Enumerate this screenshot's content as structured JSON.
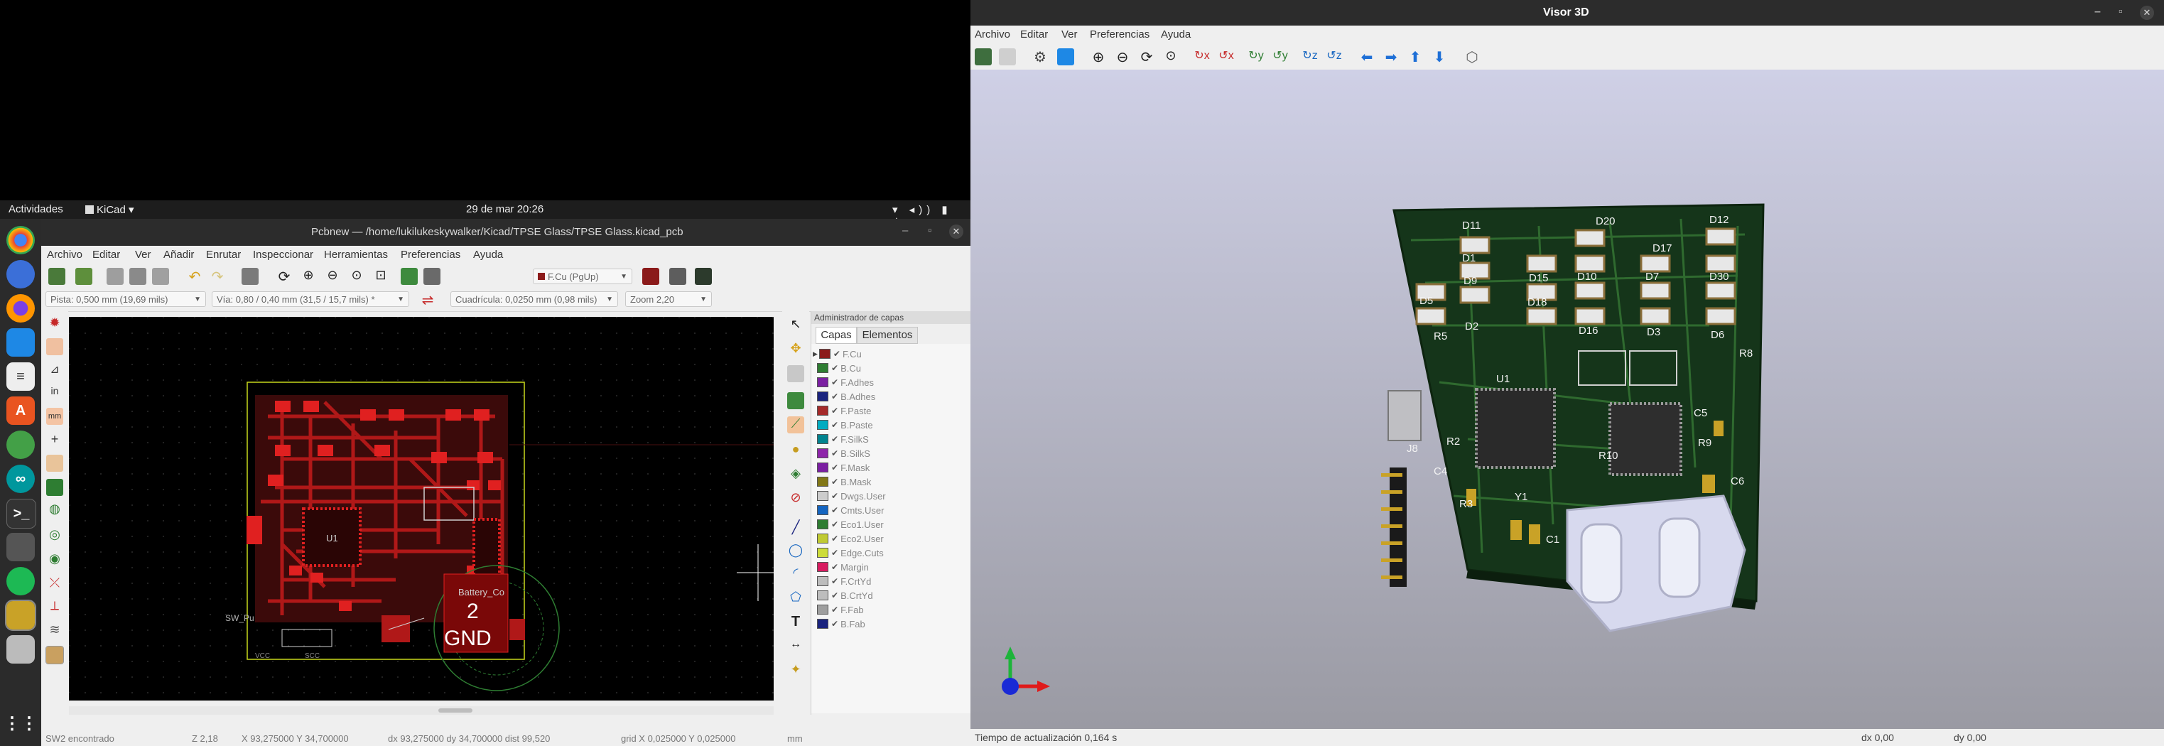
{
  "gnome": {
    "activities": "Actividades",
    "app_menu": "KiCad",
    "clock": "29 de mar  20:26"
  },
  "pcbnew": {
    "title": "Pcbnew — /home/lukilukeskywalker/Kicad/TPSE Glass/TPSE Glass.kicad_pcb",
    "menu": [
      "Archivo",
      "Editar",
      "Ver",
      "Añadir",
      "Enrutar",
      "Inspeccionar",
      "Herramientas",
      "Preferencias",
      "Ayuda"
    ],
    "layer_select": "F.Cu (PgUp)",
    "track": "Pista: 0,500 mm (19,69 mils)",
    "via": "Vía: 0,80 / 0,40 mm (31,5 / 15,7 mils) *",
    "grid": "Cuadrícula: 0,0250 mm (0,98 mils)",
    "zoom": "Zoom 2,20",
    "layers_manager": {
      "title": "Administrador de capas",
      "tabs": [
        "Capas",
        "Elementos"
      ],
      "layers": [
        {
          "name": "F.Cu",
          "color": "#8b1a1a"
        },
        {
          "name": "B.Cu",
          "color": "#2e7d32"
        },
        {
          "name": "F.Adhes",
          "color": "#7b1fa2"
        },
        {
          "name": "B.Adhes",
          "color": "#1a237e"
        },
        {
          "name": "F.Paste",
          "color": "#a52a2a"
        },
        {
          "name": "B.Paste",
          "color": "#00acc1"
        },
        {
          "name": "F.SilkS",
          "color": "#00838f"
        },
        {
          "name": "B.SilkS",
          "color": "#8e24aa"
        },
        {
          "name": "F.Mask",
          "color": "#7b1fa2"
        },
        {
          "name": "B.Mask",
          "color": "#827717"
        },
        {
          "name": "Dwgs.User",
          "color": "#cccccc"
        },
        {
          "name": "Cmts.User",
          "color": "#1565c0"
        },
        {
          "name": "Eco1.User",
          "color": "#2e7d32"
        },
        {
          "name": "Eco2.User",
          "color": "#c0ca33"
        },
        {
          "name": "Edge.Cuts",
          "color": "#cddc39"
        },
        {
          "name": "Margin",
          "color": "#d81b60"
        },
        {
          "name": "F.CrtYd",
          "color": "#bdbdbd"
        },
        {
          "name": "B.CrtYd",
          "color": "#bdbdbd"
        },
        {
          "name": "F.Fab",
          "color": "#9e9e9e"
        },
        {
          "name": "B.Fab",
          "color": "#1a237e"
        }
      ]
    },
    "board_labels": {
      "u1": "U1",
      "pad_number": "2",
      "pad_net": "GND",
      "battery": "Battery_Co",
      "sw": "SW_Pu",
      "vcc": "VCC",
      "scc": "SCC"
    },
    "status": {
      "message": "SW2 encontrado",
      "zoom": "Z 2,18",
      "xy": "X 93,275000  Y 34,700000",
      "dxy": "dx 93,275000  dy 34,700000  dist 99,520",
      "grid": "grid X 0,025000  Y 0,025000",
      "units": "mm"
    }
  },
  "viewer3d": {
    "title": "Visor 3D",
    "menu": [
      "Archivo",
      "Editar",
      "Ver",
      "Preferencias",
      "Ayuda"
    ],
    "refs": [
      "D11",
      "D20",
      "D12",
      "D17",
      "D1",
      "D15",
      "D10",
      "D7",
      "D30",
      "D5",
      "D9",
      "D18",
      "D6",
      "D2",
      "D16",
      "D3",
      "R5",
      "R8",
      "U1",
      "J8",
      "R2",
      "C4",
      "C5",
      "R9",
      "C6",
      "R3",
      "Y1",
      "C1",
      "R10"
    ],
    "status": {
      "update": "Tiempo de actualización 0,164 s",
      "dx": "dx 0,00",
      "dy": "dy 0,00"
    }
  }
}
